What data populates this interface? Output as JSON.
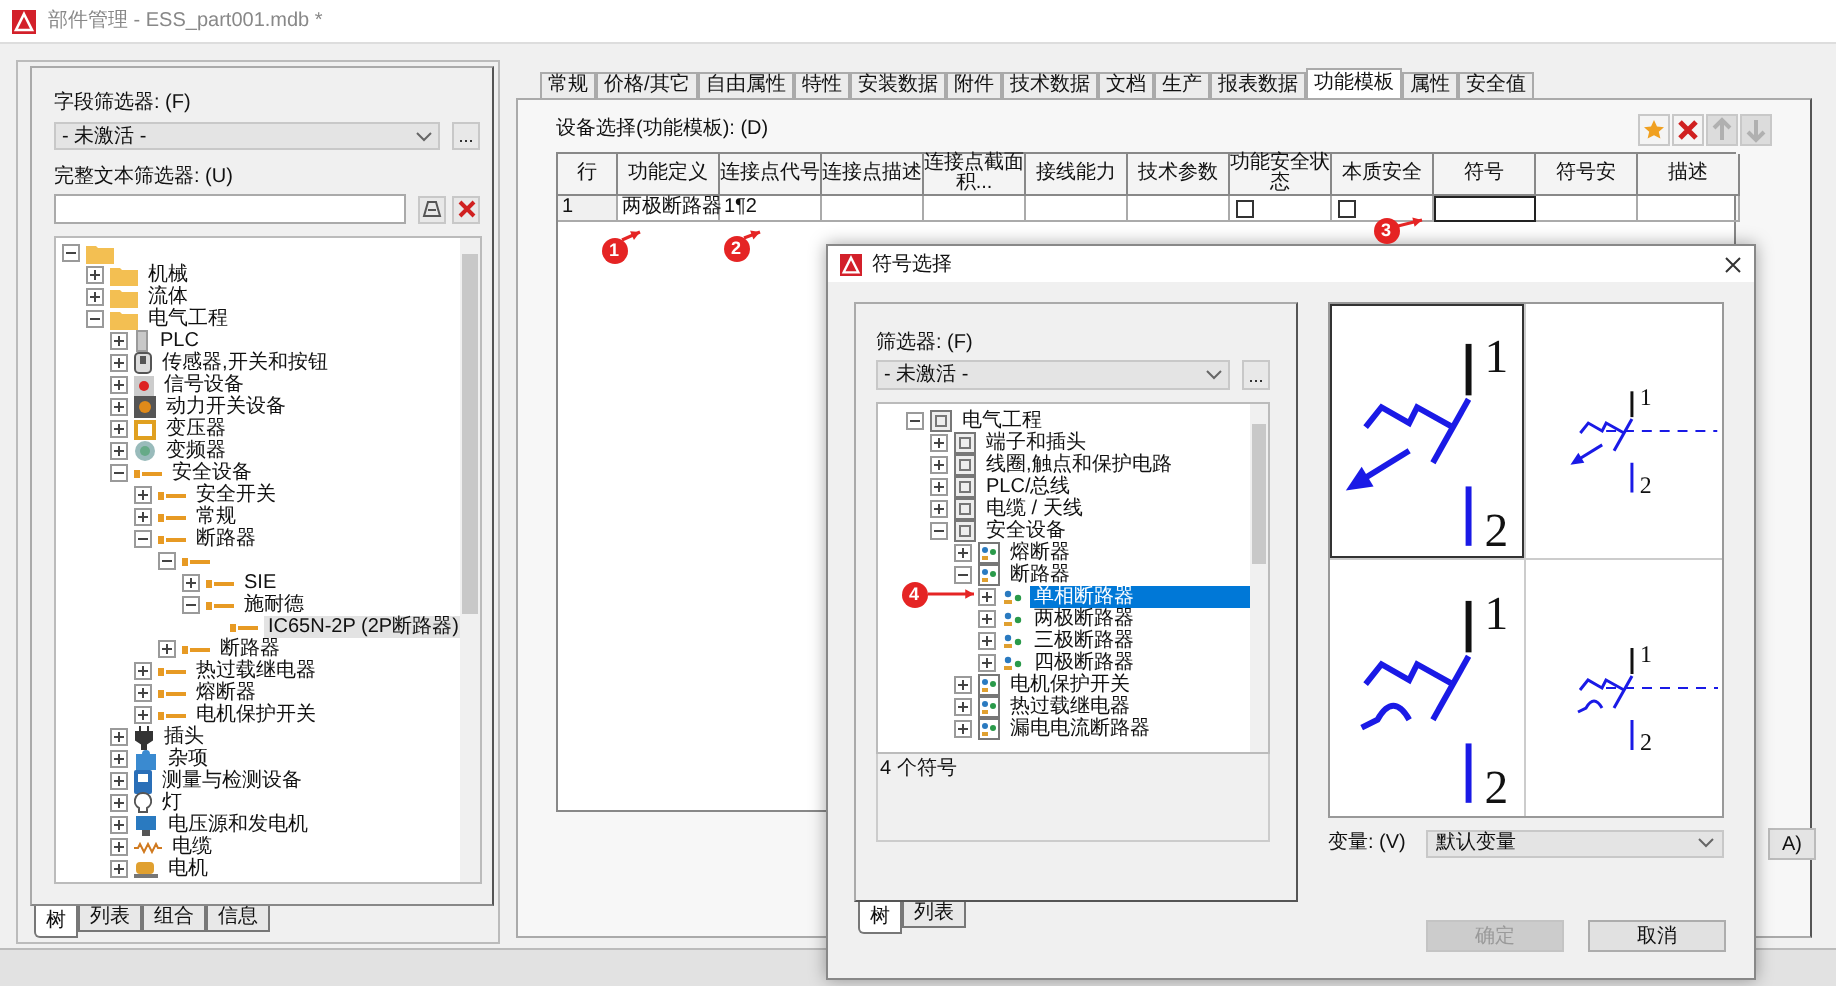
{
  "window": {
    "title": "部件管理 - ESS_part001.mdb *"
  },
  "left_panel": {
    "field_filter_label": "字段筛选器: (F)",
    "field_filter_value": "- 未激活 -",
    "more_button": "...",
    "text_filter_label": "完整文本筛选器: (U)",
    "tree": [
      {
        "kind": "folder",
        "expanded": true,
        "selected": false,
        "children": [
          {
            "label": "机械",
            "kind": "folder",
            "expanded": false,
            "selected": false
          },
          {
            "label": "流体",
            "kind": "folder",
            "expanded": false,
            "selected": false
          },
          {
            "label": "电气工程",
            "kind": "folder",
            "expanded": true,
            "selected": false,
            "children": [
              {
                "label": "PLC",
                "kind": "plc",
                "expanded": false,
                "selected": false
              },
              {
                "label": "传感器,开关和按钮",
                "kind": "sensor",
                "expanded": false,
                "selected": false
              },
              {
                "label": "信号设备",
                "kind": "signal",
                "expanded": false,
                "selected": false
              },
              {
                "label": "动力开关设备",
                "kind": "power",
                "expanded": false,
                "selected": false
              },
              {
                "label": "变压器",
                "kind": "transformer",
                "expanded": false,
                "selected": false
              },
              {
                "label": "变频器",
                "kind": "inverter",
                "expanded": false,
                "selected": false
              },
              {
                "label": "安全设备",
                "kind": "part",
                "expanded": true,
                "selected": false,
                "children": [
                  {
                    "label": "安全开关",
                    "kind": "part",
                    "expanded": false,
                    "selected": false
                  },
                  {
                    "label": "常规",
                    "kind": "part",
                    "expanded": false,
                    "selected": false
                  },
                  {
                    "label": "断路器",
                    "kind": "part",
                    "expanded": true,
                    "selected": false,
                    "children": [
                      {
                        "kind": "part",
                        "expanded": true,
                        "selected": false,
                        "children": [
                          {
                            "label": "SIE",
                            "kind": "part",
                            "expanded": false,
                            "selected": false
                          },
                          {
                            "label": "施耐德",
                            "kind": "part",
                            "expanded": true,
                            "selected": false,
                            "children": [
                              {
                                "label": "IC65N-2P (2P断路器)",
                                "kind": "part",
                                "selected": true
                              }
                            ]
                          }
                        ]
                      },
                      {
                        "label": "断路器",
                        "kind": "part",
                        "expanded": false,
                        "selected": false
                      }
                    ]
                  },
                  {
                    "label": "热过载继电器",
                    "kind": "part",
                    "expanded": false,
                    "selected": false
                  },
                  {
                    "label": "熔断器",
                    "kind": "part",
                    "expanded": false,
                    "selected": false
                  },
                  {
                    "label": "电机保护开关",
                    "kind": "part",
                    "expanded": false,
                    "selected": false
                  }
                ]
              },
              {
                "label": "插头",
                "kind": "plug",
                "expanded": false,
                "selected": false
              },
              {
                "label": "杂项",
                "kind": "misc",
                "expanded": false,
                "selected": false
              },
              {
                "label": "测量与检测设备",
                "kind": "meter",
                "expanded": false,
                "selected": false
              },
              {
                "label": "灯",
                "kind": "lamp",
                "expanded": false,
                "selected": false
              },
              {
                "label": "电压源和发电机",
                "kind": "generator",
                "expanded": false,
                "selected": false
              },
              {
                "label": "电缆",
                "kind": "cable",
                "expanded": false,
                "selected": false
              },
              {
                "label": "电机",
                "kind": "motor",
                "expanded": false,
                "selected": false
              }
            ]
          }
        ]
      }
    ],
    "tabs": [
      {
        "label": "树",
        "selected": true
      },
      {
        "label": "列表",
        "selected": false
      },
      {
        "label": "组合",
        "selected": false
      },
      {
        "label": "信息",
        "selected": false
      }
    ]
  },
  "right_panel": {
    "tabs": [
      {
        "label": "常规",
        "selected": false
      },
      {
        "label": "价格/其它",
        "selected": false
      },
      {
        "label": "自由属性",
        "selected": false
      },
      {
        "label": "特性",
        "selected": false
      },
      {
        "label": "安装数据",
        "selected": false
      },
      {
        "label": "附件",
        "selected": false
      },
      {
        "label": "技术数据",
        "selected": false
      },
      {
        "label": "文档",
        "selected": false
      },
      {
        "label": "生产",
        "selected": false
      },
      {
        "label": "报表数据",
        "selected": false
      },
      {
        "label": "功能模板",
        "selected": true
      },
      {
        "label": "属性",
        "selected": false
      },
      {
        "label": "安全值",
        "selected": false
      }
    ],
    "table_label": "设备选择(功能模板): (D)",
    "toolbar": [
      {
        "kind": "new",
        "disabled": false
      },
      {
        "kind": "delete",
        "disabled": false
      },
      {
        "kind": "up",
        "disabled": true
      },
      {
        "kind": "down",
        "disabled": true
      }
    ],
    "table": {
      "columns": [
        "行",
        "功能定义",
        "连接点代号",
        "连接点描述",
        "连接点截面积...",
        "接线能力",
        "技术参数",
        "功能安全状态",
        "本质安全",
        "符号",
        "符号安",
        "描述"
      ],
      "rows": [
        {
          "cells": [
            {
              "kind": "header",
              "value": "1",
              "selected": false
            },
            {
              "kind": "text",
              "value": "两极断路器",
              "selected": false
            },
            {
              "kind": "text",
              "value": "1¶2",
              "selected": false
            },
            {
              "kind": "text",
              "selected": false
            },
            {
              "kind": "text",
              "selected": false
            },
            {
              "kind": "text",
              "selected": false
            },
            {
              "kind": "text",
              "selected": false
            },
            {
              "kind": "checkbox",
              "checked": false,
              "selected": false
            },
            {
              "kind": "checkbox",
              "checked": false,
              "selected": false
            },
            {
              "kind": "text",
              "selected": true
            },
            {
              "kind": "text",
              "selected": false
            },
            {
              "kind": "text",
              "selected": false
            }
          ]
        }
      ]
    },
    "apply_button": "A)"
  },
  "dialog": {
    "title": "符号选择",
    "filter_label": "筛选器: (F)",
    "filter_value": "- 未激活 -",
    "more_button": "...",
    "tree": [
      {
        "label": "电气工程",
        "kind": "category",
        "expanded": true,
        "selected": false,
        "children": [
          {
            "label": "端子和插头",
            "kind": "category",
            "expanded": false,
            "selected": false
          },
          {
            "label": "线圈,触点和保护电路",
            "kind": "category",
            "expanded": false,
            "selected": false
          },
          {
            "label": "PLC/总线",
            "kind": "category",
            "expanded": false,
            "selected": false
          },
          {
            "label": "电缆 / 天线",
            "kind": "category",
            "expanded": false,
            "selected": false
          },
          {
            "label": "安全设备",
            "kind": "category",
            "expanded": true,
            "selected": false,
            "children": [
              {
                "label": "熔断器",
                "kind": "symbol_group",
                "expanded": false,
                "selected": false
              },
              {
                "label": "断路器",
                "kind": "symbol_group",
                "expanded": true,
                "selected": false,
                "children": [
                  {
                    "label": "单相断路器",
                    "kind": "symbol",
                    "expanded": false,
                    "selected": true
                  },
                  {
                    "label": "两极断路器",
                    "kind": "symbol",
                    "expanded": false,
                    "selected": false
                  },
                  {
                    "label": "三极断路器",
                    "kind": "symbol",
                    "expanded": false,
                    "selected": false
                  },
                  {
                    "label": "四极断路器",
                    "kind": "symbol",
                    "expanded": false,
                    "selected": false
                  }
                ]
              },
              {
                "label": "电机保护开关",
                "kind": "symbol_group",
                "expanded": false,
                "selected": false
              },
              {
                "label": "热过载继电器",
                "kind": "symbol_group",
                "expanded": false,
                "selected": false
              },
              {
                "label": "漏电电流断路器",
                "kind": "symbol_group",
                "expanded": false,
                "selected": false
              }
            ]
          }
        ]
      }
    ],
    "count": "4 个符号",
    "tabs": [
      {
        "label": "树",
        "selected": true
      },
      {
        "label": "列表",
        "selected": false
      }
    ],
    "symbols": [
      {
        "kind": "arrow",
        "selected": true,
        "pins": [
          "1",
          "2"
        ]
      },
      {
        "kind": "arrow",
        "selected": false,
        "pins": [
          "1",
          "2"
        ]
      },
      {
        "kind": "hook",
        "selected": false,
        "pins": [
          "1",
          "2"
        ]
      },
      {
        "kind": "hook",
        "selected": false,
        "pins": [
          "1",
          "2"
        ]
      }
    ],
    "variant_label": "变量: (V)",
    "variant_value": "默认变量",
    "buttons": [
      {
        "label": "确定",
        "disabled": true
      },
      {
        "label": "取消",
        "disabled": false
      }
    ]
  },
  "annotations": [
    {
      "label": "1"
    },
    {
      "label": "2"
    },
    {
      "label": "3"
    },
    {
      "label": "4"
    }
  ]
}
